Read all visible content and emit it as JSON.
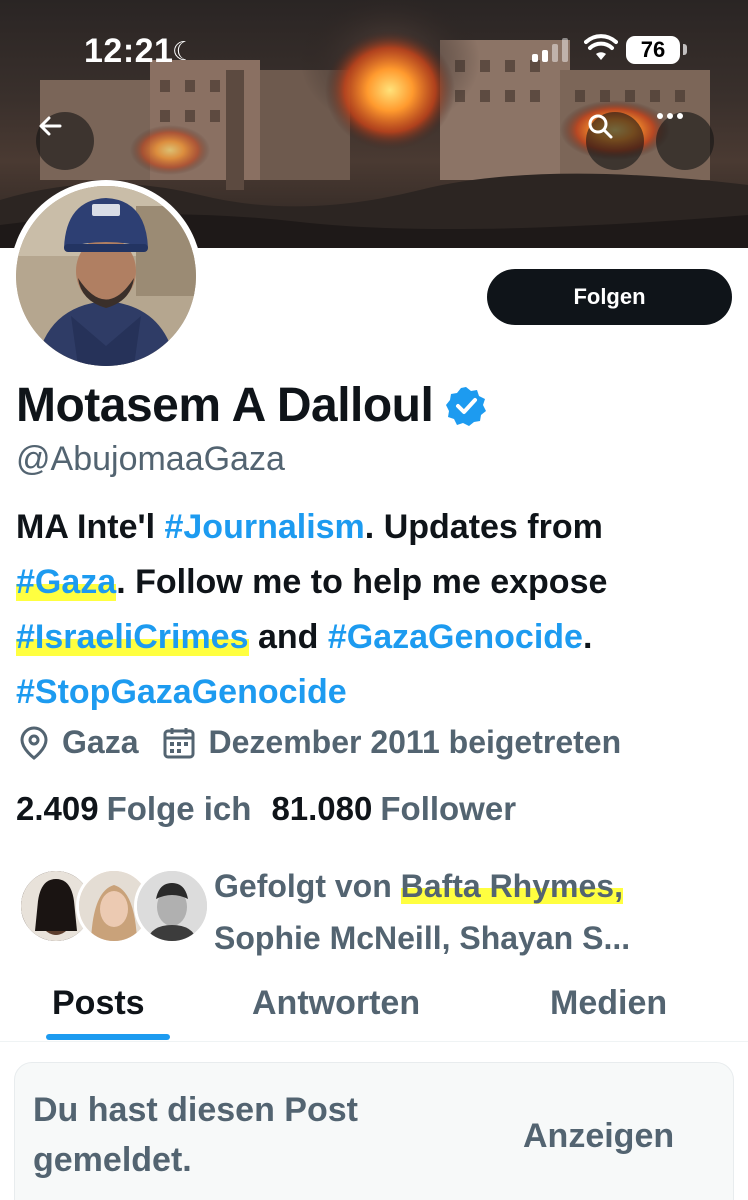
{
  "status_bar": {
    "time": "12:21",
    "battery": "76"
  },
  "header": {
    "back_icon": "arrow-left-icon",
    "search_icon": "search-icon",
    "more_icon": "more-horizontal-icon"
  },
  "profile": {
    "follow_label": "Folgen",
    "name": "Motasem A Dalloul",
    "verified_icon": "verified-badge-icon",
    "handle": "@AbujomaaGaza",
    "bio": {
      "p1": "MA Inte'l ",
      "tag_journalism": "#Journalism",
      "p2": ". Updates from ",
      "tag_gaza": "#Gaza",
      "p3": ". Follow me to help me expose ",
      "tag_crimes": "#IsraeliCrimes",
      "p4": " and ",
      "tag_genocide": "#GazaGenocide",
      "p5": ".",
      "tag_stop": "#StopGazaGenocide"
    },
    "location": "Gaza",
    "joined": "Dezember 2011 beigetreten",
    "following_count": "2.409",
    "following_label": "Folge ich",
    "followers_count": "81.080",
    "followers_label": "Follower",
    "followed_by_prefix": "Gefolgt von ",
    "followed_by_name1": "Bafta Rhymes,",
    "followed_by_rest": "Sophie McNeill, Shayan S..."
  },
  "tabs": [
    "Posts",
    "Antworten",
    "Medien"
  ],
  "reported": {
    "message": "Du hast diesen Post gemeldet.",
    "show_label": "Anzeigen"
  },
  "colors": {
    "accent": "#1d9bf0",
    "text": "#0f1419",
    "muted": "#536471",
    "highlight": "#ffff00"
  }
}
